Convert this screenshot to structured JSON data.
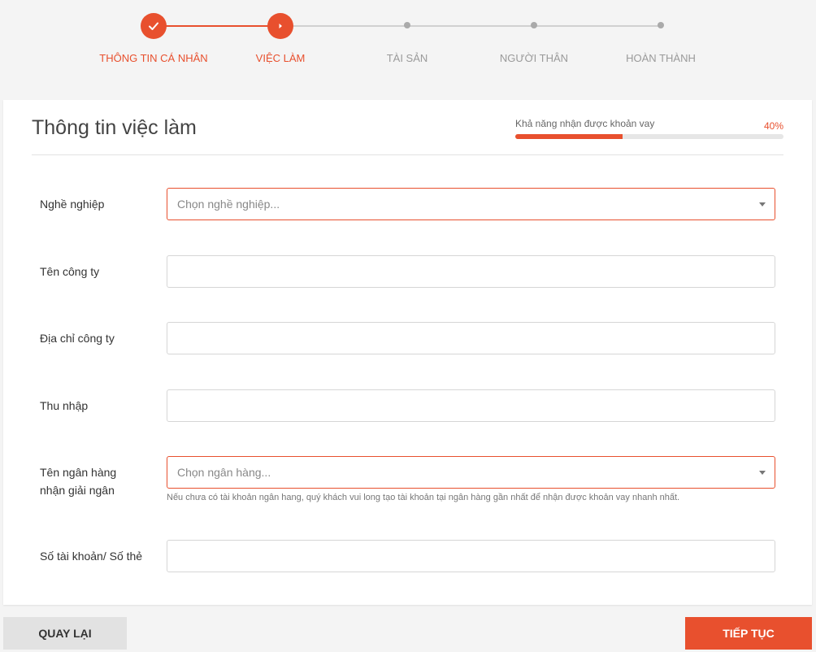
{
  "colors": {
    "accent": "#e8502e",
    "inactive": "#9a9a9a",
    "background": "#f4f4f4"
  },
  "stepper": {
    "steps": [
      {
        "label": "THÔNG TIN CÁ NHÂN",
        "state": "completed",
        "icon": "check-icon"
      },
      {
        "label": "VIỆC LÀM",
        "state": "current",
        "icon": "play-icon"
      },
      {
        "label": "TÀI SẢN",
        "state": "pending"
      },
      {
        "label": "NGƯỜI THÂN",
        "state": "pending"
      },
      {
        "label": "HOÀN THÀNH",
        "state": "pending"
      }
    ]
  },
  "card": {
    "title": "Thông tin việc làm",
    "progress": {
      "label": "Khả năng nhận được khoản vay",
      "percent_text": "40%",
      "value": 0.4
    }
  },
  "form": {
    "occupation": {
      "label": "Nghề nghiệp",
      "placeholder": "Chọn nghề nghiệp...",
      "value": ""
    },
    "company_name": {
      "label": "Tên công ty",
      "value": ""
    },
    "company_address": {
      "label": "Địa chỉ công ty",
      "value": ""
    },
    "income": {
      "label": "Thu nhập",
      "value": ""
    },
    "bank": {
      "label_line1": "Tên ngân hàng",
      "label_line2": "nhận giải ngân",
      "placeholder": "Chọn ngân hàng...",
      "hint": "Nếu chưa có tài khoản ngân hang, quý khách vui long tạo tài khoản tại ngân hàng gần nhất để nhận được khoản vay nhanh nhất."
    },
    "account_number": {
      "label": "Số tài khoản/ Số thẻ",
      "value": ""
    }
  },
  "buttons": {
    "back": "QUAY LẠI",
    "next": "TIẾP TỤC"
  }
}
